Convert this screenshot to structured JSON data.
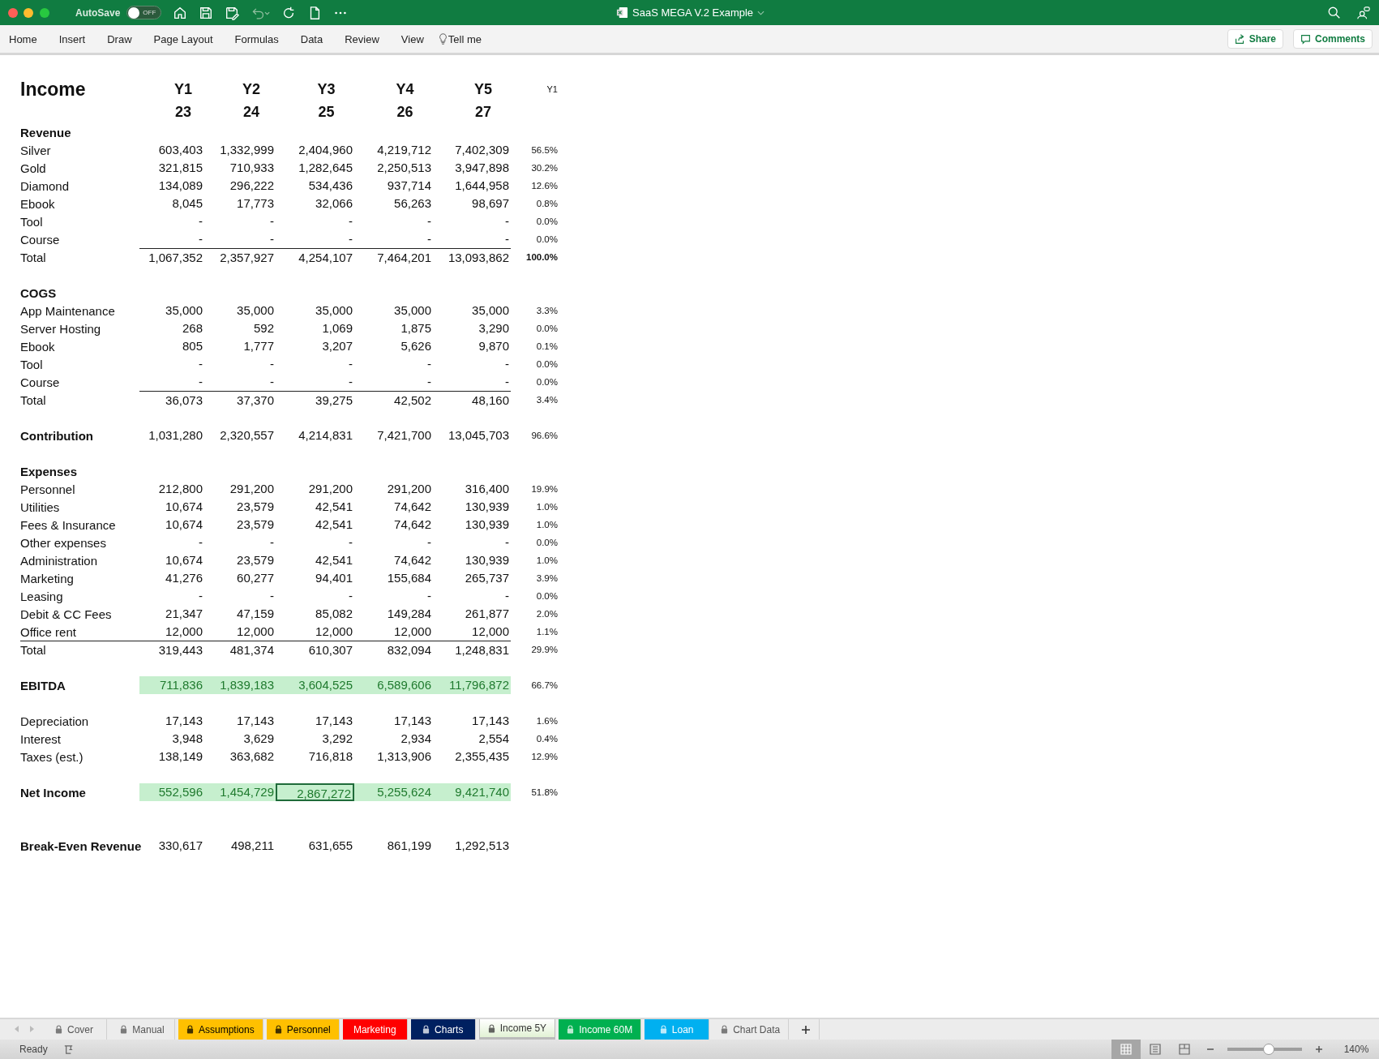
{
  "window": {
    "title": "SaaS MEGA V.2 Example",
    "autosave_label": "AutoSave",
    "autosave": {
      "on": false,
      "text": "OFF"
    }
  },
  "ribbon": {
    "tabs": [
      "Home",
      "Insert",
      "Draw",
      "Page Layout",
      "Formulas",
      "Data",
      "Review",
      "View"
    ],
    "tell_me": "Tell me",
    "share": "Share",
    "comments": "Comments"
  },
  "sheet": {
    "title": "Income",
    "years": [
      "Y1",
      "Y2",
      "Y3",
      "Y4",
      "Y5"
    ],
    "year_numbers": [
      "23",
      "24",
      "25",
      "26",
      "27"
    ],
    "share_header": "Y1",
    "rows": [
      {
        "kind": "section",
        "label": "Revenue"
      },
      {
        "kind": "item",
        "label": "Silver",
        "values": [
          "603,403",
          "1,332,999",
          "2,404,960",
          "4,219,712",
          "7,402,309"
        ],
        "share": "56.5%"
      },
      {
        "kind": "item",
        "label": "Gold",
        "values": [
          "321,815",
          "710,933",
          "1,282,645",
          "2,250,513",
          "3,947,898"
        ],
        "share": "30.2%"
      },
      {
        "kind": "item",
        "label": "Diamond",
        "values": [
          "134,089",
          "296,222",
          "534,436",
          "937,714",
          "1,644,958"
        ],
        "share": "12.6%"
      },
      {
        "kind": "item",
        "label": "Ebook",
        "values": [
          "8,045",
          "17,773",
          "32,066",
          "56,263",
          "98,697"
        ],
        "share": "0.8%"
      },
      {
        "kind": "item",
        "label": "Tool",
        "values": [
          "-",
          "-",
          "-",
          "-",
          "-"
        ],
        "share": "0.0%"
      },
      {
        "kind": "item",
        "label": "Course",
        "values": [
          "-",
          "-",
          "-",
          "-",
          "-"
        ],
        "share": "0.0%"
      },
      {
        "kind": "total",
        "rule_spans_label": false,
        "share_bold": true,
        "label": "Total",
        "values": [
          "1,067,352",
          "2,357,927",
          "4,254,107",
          "7,464,201",
          "13,093,862"
        ],
        "share": "100.0%"
      },
      {
        "kind": "blank"
      },
      {
        "kind": "section",
        "label": "COGS"
      },
      {
        "kind": "item",
        "label": "App Maintenance",
        "values": [
          "35,000",
          "35,000",
          "35,000",
          "35,000",
          "35,000"
        ],
        "share": "3.3%"
      },
      {
        "kind": "item",
        "label": "Server Hosting",
        "values": [
          "268",
          "592",
          "1,069",
          "1,875",
          "3,290"
        ],
        "share": "0.0%"
      },
      {
        "kind": "item",
        "label": "Ebook",
        "values": [
          "805",
          "1,777",
          "3,207",
          "5,626",
          "9,870"
        ],
        "share": "0.1%"
      },
      {
        "kind": "item",
        "label": "Tool",
        "values": [
          "-",
          "-",
          "-",
          "-",
          "-"
        ],
        "share": "0.0%"
      },
      {
        "kind": "item",
        "label": "Course",
        "values": [
          "-",
          "-",
          "-",
          "-",
          "-"
        ],
        "share": "0.0%"
      },
      {
        "kind": "total",
        "rule_spans_label": false,
        "share_bold": false,
        "label": "Total",
        "values": [
          "36,073",
          "37,370",
          "39,275",
          "42,502",
          "48,160"
        ],
        "share": "3.4%"
      },
      {
        "kind": "blank"
      },
      {
        "kind": "bold",
        "label": "Contribution",
        "values": [
          "1,031,280",
          "2,320,557",
          "4,214,831",
          "7,421,700",
          "13,045,703"
        ],
        "share": "96.6%"
      },
      {
        "kind": "blank"
      },
      {
        "kind": "section",
        "label": "Expenses"
      },
      {
        "kind": "item",
        "label": "Personnel",
        "values": [
          "212,800",
          "291,200",
          "291,200",
          "291,200",
          "316,400"
        ],
        "share": "19.9%"
      },
      {
        "kind": "item",
        "label": "Utilities",
        "values": [
          "10,674",
          "23,579",
          "42,541",
          "74,642",
          "130,939"
        ],
        "share": "1.0%"
      },
      {
        "kind": "item",
        "label": "Fees & Insurance",
        "values": [
          "10,674",
          "23,579",
          "42,541",
          "74,642",
          "130,939"
        ],
        "share": "1.0%"
      },
      {
        "kind": "item",
        "label": "Other expenses",
        "values": [
          "-",
          "-",
          "-",
          "-",
          "-"
        ],
        "share": "0.0%"
      },
      {
        "kind": "item",
        "label": "Administration",
        "values": [
          "10,674",
          "23,579",
          "42,541",
          "74,642",
          "130,939"
        ],
        "share": "1.0%"
      },
      {
        "kind": "item",
        "label": "Marketing",
        "values": [
          "41,276",
          "60,277",
          "94,401",
          "155,684",
          "265,737"
        ],
        "share": "3.9%"
      },
      {
        "kind": "item",
        "label": "Leasing",
        "values": [
          "-",
          "-",
          "-",
          "-",
          "-"
        ],
        "share": "0.0%"
      },
      {
        "kind": "item",
        "label": "Debit & CC Fees",
        "values": [
          "21,347",
          "47,159",
          "85,082",
          "149,284",
          "261,877"
        ],
        "share": "2.0%"
      },
      {
        "kind": "item",
        "label": "Office rent",
        "values": [
          "12,000",
          "12,000",
          "12,000",
          "12,000",
          "12,000"
        ],
        "share": "1.1%"
      },
      {
        "kind": "total",
        "rule_spans_label": true,
        "share_bold": false,
        "label": "Total",
        "values": [
          "319,443",
          "481,374",
          "610,307",
          "832,094",
          "1,248,831"
        ],
        "share": "29.9%"
      },
      {
        "kind": "blank"
      },
      {
        "kind": "highlight",
        "label": "EBITDA",
        "values": [
          {
            "text": "711,836",
            "selected": false
          },
          {
            "text": "1,839,183",
            "selected": false
          },
          {
            "text": "3,604,525",
            "selected": false
          },
          {
            "text": "6,589,606",
            "selected": false
          },
          {
            "text": "11,796,872",
            "selected": false
          }
        ],
        "share": "66.7%"
      },
      {
        "kind": "blank"
      },
      {
        "kind": "item",
        "label": "Depreciation",
        "values": [
          "17,143",
          "17,143",
          "17,143",
          "17,143",
          "17,143"
        ],
        "share": "1.6%"
      },
      {
        "kind": "item",
        "label": "Interest",
        "values": [
          "3,948",
          "3,629",
          "3,292",
          "2,934",
          "2,554"
        ],
        "share": "0.4%"
      },
      {
        "kind": "item",
        "label": "Taxes (est.)",
        "values": [
          "138,149",
          "363,682",
          "716,818",
          "1,313,906",
          "2,355,435"
        ],
        "share": "12.9%"
      },
      {
        "kind": "blank"
      },
      {
        "kind": "highlight",
        "label": "Net Income",
        "values": [
          {
            "text": "552,596",
            "selected": false
          },
          {
            "text": "1,454,729",
            "selected": false
          },
          {
            "text": "2,867,272",
            "selected": true
          },
          {
            "text": "5,255,624",
            "selected": false
          },
          {
            "text": "9,421,740",
            "selected": false
          }
        ],
        "share": "51.8%"
      },
      {
        "kind": "blank"
      },
      {
        "kind": "blank"
      },
      {
        "kind": "bold",
        "label": "Break-Even Revenue",
        "values": [
          "330,617",
          "498,211",
          "631,655",
          "861,199",
          "1,292,513"
        ]
      }
    ]
  },
  "sheet_tabs": [
    {
      "label": "Cover",
      "locked": true,
      "selected": false
    },
    {
      "label": "Manual",
      "locked": true,
      "selected": false
    },
    {
      "label": "Assumptions",
      "locked": true,
      "selected": false,
      "color": "#ffc000"
    },
    {
      "label": "Personnel",
      "locked": true,
      "selected": false,
      "color": "#ffc000"
    },
    {
      "label": "Marketing",
      "locked": false,
      "selected": false,
      "color": "#ff0000"
    },
    {
      "label": "Charts",
      "locked": true,
      "selected": false,
      "color": "#002060"
    },
    {
      "label": "Income 5Y",
      "locked": true,
      "selected": true
    },
    {
      "label": "Income 60M",
      "locked": true,
      "selected": false,
      "color": "#00b050"
    },
    {
      "label": "Loan",
      "locked": true,
      "selected": false,
      "color": "#00b0f0"
    },
    {
      "label": "Chart Data",
      "locked": true,
      "selected": false
    }
  ],
  "status_bar": {
    "status": "Ready",
    "zoom": {
      "level": 0.55,
      "text": "140%"
    }
  }
}
